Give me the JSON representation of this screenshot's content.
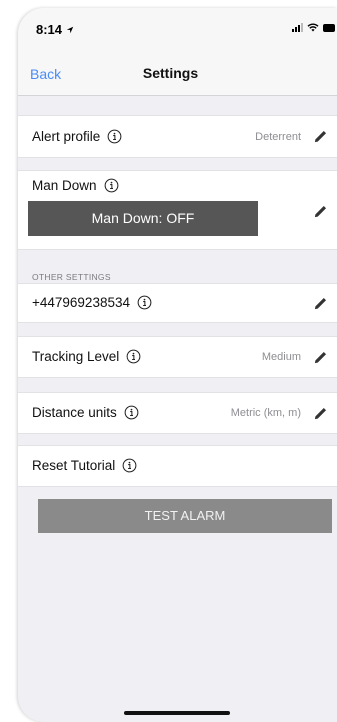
{
  "status_bar": {
    "time": "8:14"
  },
  "nav": {
    "back_label": "Back",
    "title": "Settings"
  },
  "rows": {
    "alert_profile": {
      "label": "Alert profile",
      "value": "Deterrent"
    },
    "man_down": {
      "label": "Man Down",
      "button_label": "Man Down: OFF"
    },
    "other_settings_header": "OTHER SETTINGS",
    "phone": {
      "label": "+447969238534"
    },
    "tracking_level": {
      "label": "Tracking Level",
      "value": "Medium"
    },
    "distance_units": {
      "label": "Distance units",
      "value": "Metric (km, m)"
    },
    "reset_tutorial": {
      "label": "Reset Tutorial"
    }
  },
  "test_alarm_label": "TEST ALARM",
  "colors": {
    "link": "#4a8cf7",
    "button_dark": "#565656",
    "button_grey": "#8a8a8a",
    "background": "#efeff4"
  },
  "icons": [
    "location-arrow-icon",
    "signal-icon",
    "wifi-icon",
    "battery-icon",
    "info-icon",
    "pencil-icon"
  ]
}
